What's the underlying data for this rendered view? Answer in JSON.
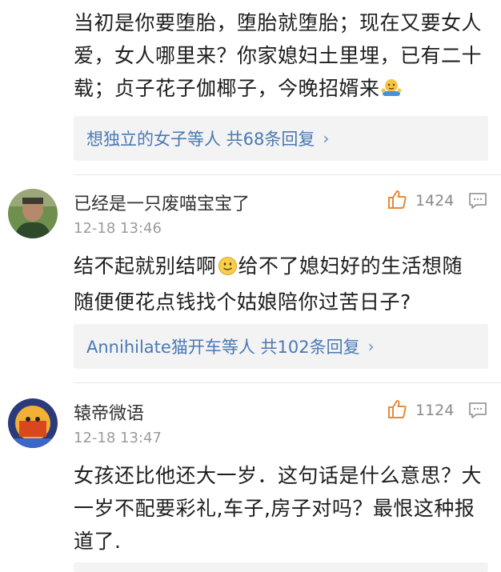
{
  "top_comment": {
    "line1": "当初是你要堕胎，堕胎就堕胎；现在又要女人",
    "line2": "爱，女人哪里来？你家媳妇土里埋，已有二十",
    "line3": "载；贞子花子伽椰子，今晚招婿来",
    "emoji": "shrug-emoji",
    "replies": "想独立的女子等人  共68条回复"
  },
  "comments": [
    {
      "username": "已经是一只废喵宝宝了",
      "time": "12-18 13:46",
      "likes": "1424",
      "text_a": "结不起就别结啊",
      "emoji": "smile-emoji",
      "text_b": "给不了媳妇好的生活想随",
      "line2": "随便便花点钱找个姑娘陪你过苦日子?",
      "replies": "Annihilate猫开车等人  共102条回复"
    },
    {
      "username": "辕帝微语",
      "time": "12-18 13:47",
      "likes": "1124",
      "line1": "女孩还比他还大一岁．这句话是什么意思？大",
      "line2": "一岁不配要彩礼,车子,房子对吗？最恨这种报",
      "line3": "道了."
    }
  ],
  "icons": {
    "like": "thumbs-up-icon",
    "comment": "comment-icon",
    "chevron": "chevron-right-icon"
  },
  "colors": {
    "link": "#4a79b4",
    "like_icon": "#e58a3a",
    "reply_bg": "#f3f3f3"
  }
}
